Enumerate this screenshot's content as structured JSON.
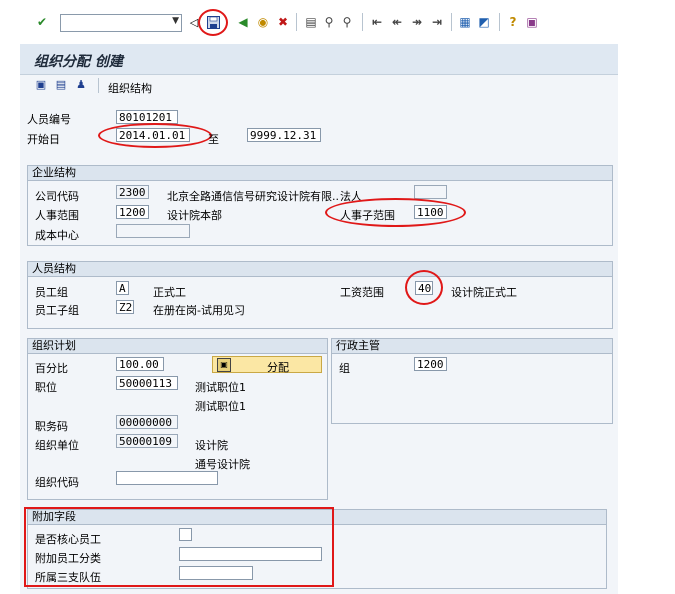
{
  "toolbar": {
    "command_field_value": "",
    "icons": [
      "check-icon",
      "back-arrow-icon",
      "save-icon",
      "back-icon",
      "exit-icon",
      "cancel-icon",
      "print-icon",
      "find-icon",
      "find-next-icon",
      "first-page-icon",
      "previous-page-icon",
      "next-page-icon",
      "last-page-icon",
      "new-session-icon",
      "shortcut-icon",
      "help-icon",
      "layout-icon"
    ]
  },
  "title": "组织分配 创建",
  "appbar": {
    "org_structure_label": "组织结构"
  },
  "header": {
    "personnel_no_label": "人员编号",
    "personnel_no": "80101201",
    "start_label": "开始日",
    "start_date": "2014.01.01",
    "to_label": "至",
    "end_date": "9999.12.31"
  },
  "enterprise": {
    "title": "企业结构",
    "company_code_label": "公司代码",
    "company_code": "2300",
    "company_name": "北京全路通信信号研究设计院有限..",
    "legal_label": "法人",
    "legal_value": "",
    "pa_label": "人事范围",
    "pa_value": "1200",
    "pa_text": "设计院本部",
    "psa_label": "人事子范围",
    "psa_value": "1100",
    "cost_center_label": "成本中心",
    "cost_center_value": ""
  },
  "personnel": {
    "title": "人员结构",
    "eg_label": "员工组",
    "eg_value": "A",
    "eg_text": "正式工",
    "esg_label": "员工子组",
    "esg_value": "Z2",
    "esg_text": "在册在岗-试用见习",
    "payroll_label": "工资范围",
    "payroll_value": "40",
    "payroll_text": "设计院正式工"
  },
  "org_plan": {
    "title": "组织计划",
    "pct_label": "百分比",
    "pct_value": "100.00",
    "assign_label": "分配",
    "position_label": "职位",
    "position_value": "50000113",
    "position_text1": "测试职位1",
    "position_text2": "测试职位1",
    "job_label": "职务码",
    "job_value": "00000000",
    "org_unit_label": "组织单位",
    "org_unit_value": "50000109",
    "org_unit_text1": "设计院",
    "org_unit_text2": "通号设计院",
    "org_key_label": "组织代码",
    "org_key_value": ""
  },
  "admin": {
    "title": "行政主管",
    "group_label": "组",
    "group_value": "1200"
  },
  "additional": {
    "title": "附加字段",
    "core_label": "是否核心员工",
    "extra_cat_label": "附加员工分类",
    "extra_cat_value": "",
    "team_label": "所属三支队伍",
    "team_value": ""
  }
}
